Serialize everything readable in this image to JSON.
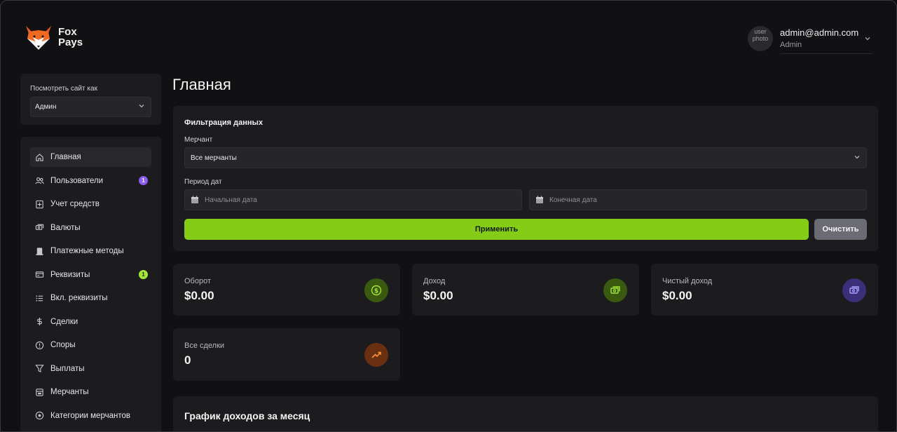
{
  "app": {
    "logo_line1": "Fox",
    "logo_line2": "Pays"
  },
  "user": {
    "avatar_alt": "user photo",
    "email": "admin@admin.com",
    "role": "Admin"
  },
  "view_as": {
    "label": "Посмотреть сайт как",
    "selected": "Админ"
  },
  "nav": {
    "items": [
      {
        "label": "Главная",
        "icon": "home-icon",
        "active": true
      },
      {
        "label": "Пользователи",
        "icon": "users-icon",
        "badge": "1",
        "badge_color": "#8b5cf6"
      },
      {
        "label": "Учет средств",
        "icon": "ledger-icon"
      },
      {
        "label": "Валюты",
        "icon": "currency-icon"
      },
      {
        "label": "Платежные методы",
        "icon": "payment-methods-icon"
      },
      {
        "label": "Реквизиты",
        "icon": "credit-card-icon",
        "badge": "1",
        "badge_color": "#a3e635"
      },
      {
        "label": "Вкл. реквизиты",
        "icon": "list-icon"
      },
      {
        "label": "Сделки",
        "icon": "dollar-icon"
      },
      {
        "label": "Споры",
        "icon": "alert-circle-icon"
      },
      {
        "label": "Выплаты",
        "icon": "filter-icon"
      },
      {
        "label": "Мерчанты",
        "icon": "store-icon"
      },
      {
        "label": "Категории мерчантов",
        "icon": "category-icon"
      }
    ]
  },
  "main": {
    "title": "Главная",
    "filter": {
      "title": "Фильтрация данных",
      "merchant_label": "Мерчант",
      "merchant_value": "Все мерчанты",
      "period_label": "Период дат",
      "start_placeholder": "Начальная дата",
      "end_placeholder": "Конечная дата",
      "apply": "Применить",
      "clear": "Очистить"
    },
    "stats": [
      {
        "label": "Оборот",
        "value": "$0.00",
        "icon": "dollar-circle-icon",
        "color": "#84cc16"
      },
      {
        "label": "Доход",
        "value": "$0.00",
        "icon": "cash-icon",
        "color": "#84cc16"
      },
      {
        "label": "Чистый доход",
        "value": "$0.00",
        "icon": "cash-icon",
        "color": "#8b7cf6"
      },
      {
        "label": "Все сделки",
        "value": "0",
        "icon": "trending-up-icon",
        "color": "#f97316"
      }
    ],
    "chart_title": "График доходов за месяц"
  },
  "colors": {
    "accent": "#84cc16",
    "background": "#111113",
    "card": "#1c1c1f"
  }
}
